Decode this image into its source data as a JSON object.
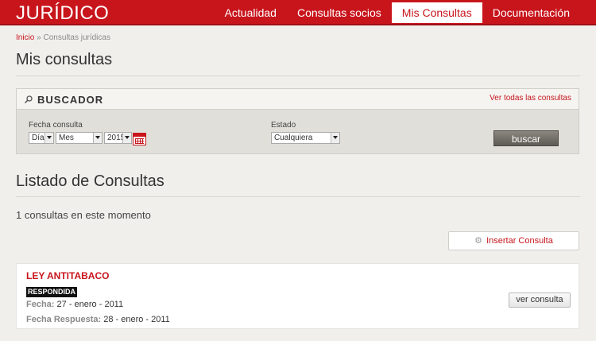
{
  "app": {
    "logo": "JURÍDICO"
  },
  "nav": {
    "items": [
      {
        "label": "Actualidad"
      },
      {
        "label": "Consultas socios"
      },
      {
        "label": "Mis Consultas"
      },
      {
        "label": "Documentación"
      }
    ],
    "active": "Mis Consultas"
  },
  "breadcrumb": {
    "home": "Inicio",
    "sep": "»",
    "current": "Consultas jurídicas"
  },
  "page": {
    "title": "Mis consultas"
  },
  "buscador": {
    "title": "BUSCADOR",
    "ver_todas": "Ver todas las consultas",
    "fecha_label": "Fecha consulta",
    "dia": "Día",
    "mes": "Mes",
    "anio": "2015",
    "estado_label": "Estado",
    "estado": "Cualquiera",
    "buscar": "buscar"
  },
  "listado": {
    "title": "Listado de Consultas",
    "count_text": "1 consultas en este momento",
    "insertar": "Insertar Consulta"
  },
  "consultas": [
    {
      "title": "LEY ANTITABACO",
      "status": "RESPONDIDA",
      "fecha_label": "Fecha:",
      "fecha": "27 - enero - 2011",
      "fecha_resp_label": "Fecha Respuesta:",
      "fecha_resp": "28 - enero - 2011",
      "ver": "ver consulta"
    }
  ],
  "colors": {
    "brand": "#c8151c",
    "background": "#f0efec"
  }
}
